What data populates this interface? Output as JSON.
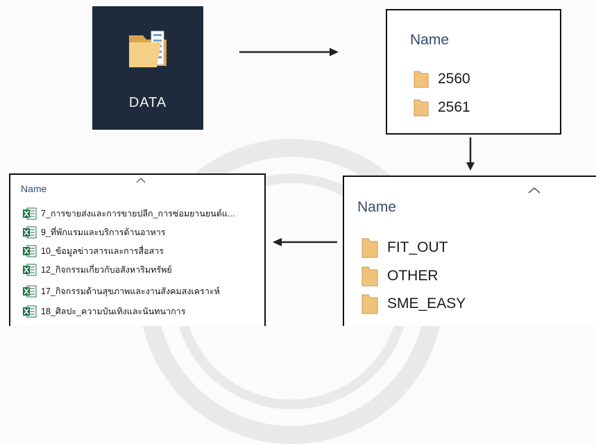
{
  "root_folder": {
    "label": "DATA",
    "icon": "folder-icon"
  },
  "years_panel": {
    "header": "Name",
    "items": [
      {
        "label": "2560",
        "icon": "folder-icon"
      },
      {
        "label": "2561",
        "icon": "folder-icon"
      }
    ]
  },
  "categories_panel": {
    "header": "Name",
    "sort_icon": "chevron-up-icon",
    "items": [
      {
        "label": "FIT_OUT",
        "icon": "folder-icon"
      },
      {
        "label": "OTHER",
        "icon": "folder-icon"
      },
      {
        "label": "SME_EASY",
        "icon": "folder-icon"
      }
    ]
  },
  "files_panel": {
    "header": "Name",
    "sort_icon": "chevron-up-icon",
    "items": [
      {
        "label": "7_การขายส่งและการขายปลีก_การซ่อมยานยนต์แ...",
        "icon": "excel-file-icon"
      },
      {
        "label": "9_ที่พักแรมและบริการด้านอาหาร",
        "icon": "excel-file-icon"
      },
      {
        "label": "10_ข้อมูลข่าวสารและการสื่อสาร",
        "icon": "excel-file-icon"
      },
      {
        "label": "12_กิจกรรมเกี่ยวกับอสังหาริมทรัพย์",
        "icon": "excel-file-icon"
      },
      {
        "label": "17_กิจกรรมด้านสุขภาพและงานสังคมสงเคราะห์",
        "icon": "excel-file-icon"
      },
      {
        "label": "18_ศิลปะ_ความบันเทิงและนันทนาการ",
        "icon": "excel-file-icon"
      }
    ]
  },
  "colors": {
    "tile_bg": "#1f2a3c",
    "folder": "#f0c27a",
    "excel": "#1e7145"
  }
}
